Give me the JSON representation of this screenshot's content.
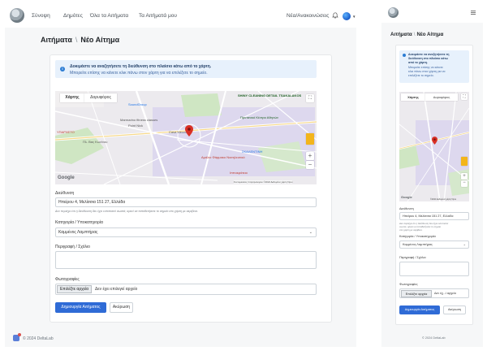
{
  "nav": {
    "links": [
      "Σύνοψη",
      "Δημότες",
      "Όλα τα Αιτήματα",
      "Τα Αιτήματά μου"
    ],
    "right_link": "Νέα/Ανακοινώσεις"
  },
  "page": {
    "breadcrumb_parent": "Αιτήματα",
    "separator": "\\",
    "breadcrumb_current": "Νέο Αίτημα"
  },
  "alert": {
    "line1": "Δοκιμάστε να αναζητήσετε τη διεύθυνση στο πλαίσιο κάτω από το χάρτη.",
    "line2": "Μπορείτε επίσης να κάνετε κλικ πάνω στον χάρτη για να επιλέξετε το σημείο.",
    "mobile_lines": [
      "Δοκιμάστε να αναζητήσετε τη",
      "διεύθυνση στο πλαίσιο κάτω",
      "από το χάρτη.",
      "Μπορείτε επίσης να κάνετε",
      "κλικ πάνω στον χάρτη για να",
      "επιλέξετε το σημείο."
    ]
  },
  "map": {
    "tab_map": "Χάρτης",
    "tab_satellite": "Δορυφόρος",
    "google": "Google",
    "attribution": "Συντομεύσεις πληκτρολογίου   ©2024 Δεδομένα χάρτη   Όροι",
    "attribution_mobile": "©2024 Δεδομένα χάρτη   Όροι",
    "places": [
      "SoundGroup",
      "SHINY CLEANING DETAIL TSAKALAKOS",
      "Point Nick",
      "Ανθρωπίνων Δικαιωμάτων",
      "Marmarino fitness classes",
      "Πρυτανικό Κέντρο Αθηνών",
      "ΥΠΑΡΧΕΤΟ",
      "Πλ. Βας Κων/νου",
      "ΣΚΑΛΕΝΤΙΝΗ",
      "Αμάλιο Φάρμακο Νοσηλευτικό",
      "Ιπποκράτειο",
      "Κεντρικό Κέντρο Συγκεντρώσεων",
      "Tacos",
      "Casa Mezzo"
    ]
  },
  "form": {
    "address_label": "Διεύθυνση",
    "address_value": "Ηπείρου 4, Μελίσσια 151 27, Ελλάδα",
    "address_hint": "Δεν περιέχει ότι η διεύθυνση δεν έχει εντοπιστεί σωστά, αρκεί να τοποθετήσετε το σημείο στο χάρτη με ακρίβεια.",
    "address_hint_mobile": [
      "Δεν περιέχει ότι η διεύθυνση δεν έχει εντοπιστεί",
      "σωστά, αρκεί να τοποθετήσετε το σημείο",
      "στο χάρτη με ακρίβεια."
    ],
    "category_label": "Κατηγορία / Υποκατηγορία",
    "category_value": "Καμμένος Λαμπτήρας",
    "description_label": "Περιγραφή / Σχόλιο",
    "photos_label": "Φωτογραφίες",
    "file_button": "Επιλέξτε αρχεία",
    "file_status": "Δεν έχει επιλεγεί αρχείο",
    "file_status_mobile": "Δεν έχ...ί αρχείο",
    "submit": "Δημιουργία Αιτήματος",
    "cancel": "Ακύρωση"
  },
  "footer": {
    "text": "© 2024 DeltaLab"
  },
  "colors": {
    "primary": "#2f6bd6",
    "alert_bg": "#e7f1fc",
    "page_bg": "#f6f7f8",
    "marker": "#d93025"
  }
}
